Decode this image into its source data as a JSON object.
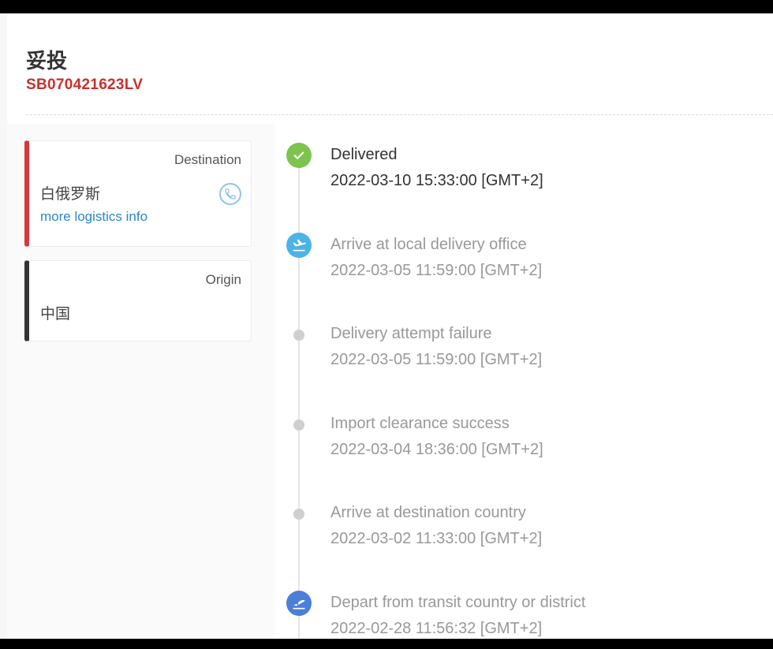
{
  "header": {
    "status": "妥投",
    "tracking_number": "SB070421623LV"
  },
  "destination": {
    "label": "Destination",
    "country": "白俄罗斯",
    "more_link": "more logistics info",
    "phone_icon": "phone-icon"
  },
  "origin": {
    "label": "Origin",
    "country": "中国"
  },
  "colors": {
    "tracking_number": "#c9302c",
    "destination_accent": "#d9363e",
    "origin_accent": "#333333",
    "link": "#2a87c8",
    "delivered_marker": "#7cc44e",
    "arrive_marker": "#4bb3e6",
    "depart_marker": "#4a7fd8",
    "dot_marker": "#cfcfcf"
  },
  "events": [
    {
      "status": "Delivered",
      "time": "2022-03-10 15:33:00 [GMT+2]",
      "icon": "check-icon"
    },
    {
      "status": "Arrive at local delivery office",
      "time": "2022-03-05 11:59:00 [GMT+2]",
      "icon": "plane-landing-icon"
    },
    {
      "status": "Delivery attempt failure",
      "time": "2022-03-05 11:59:00 [GMT+2]",
      "icon": "dot-icon"
    },
    {
      "status": "Import clearance success",
      "time": "2022-03-04 18:36:00 [GMT+2]",
      "icon": "dot-icon"
    },
    {
      "status": "Arrive at destination country",
      "time": "2022-03-02 11:33:00 [GMT+2]",
      "icon": "dot-icon"
    },
    {
      "status": "Depart from transit country or district",
      "time": "2022-02-28 11:56:32 [GMT+2]",
      "icon": "plane-takeoff-icon"
    }
  ]
}
